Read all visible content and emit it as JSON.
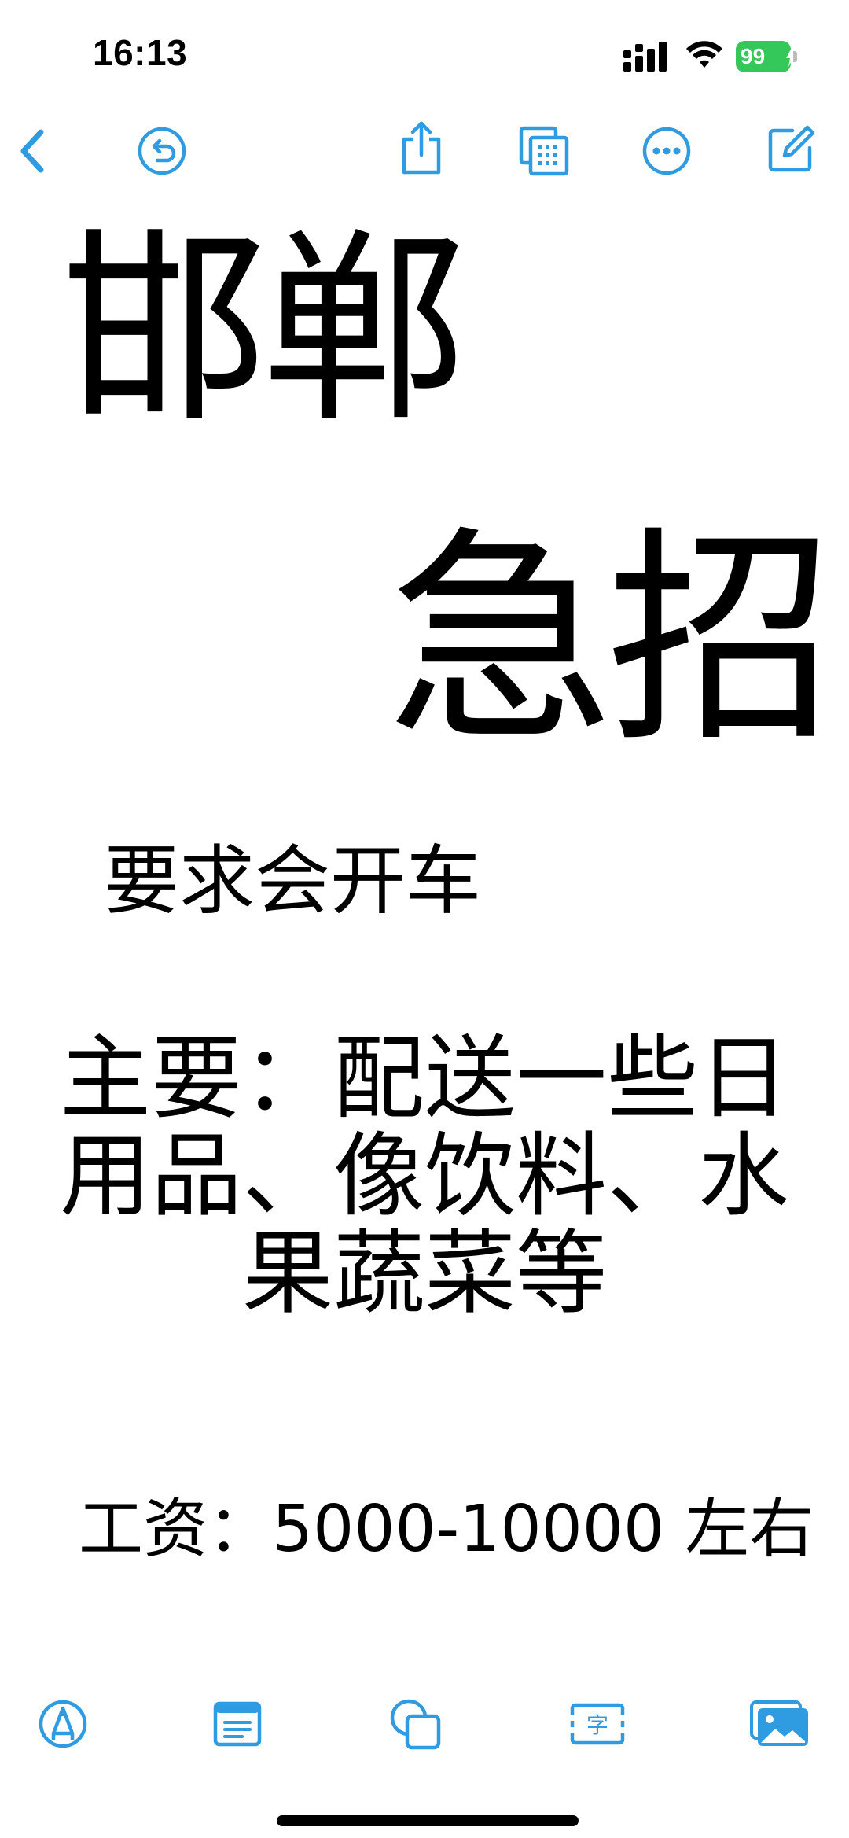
{
  "status_bar": {
    "time": "16:13",
    "battery_level": "99",
    "battery_charging": true,
    "icons": [
      "signal-icon",
      "wifi-icon",
      "battery-icon"
    ]
  },
  "toolbar": {
    "accent_color": "#2f9be0",
    "buttons": [
      "back-icon",
      "undo-icon",
      "share-icon",
      "gallery-icon",
      "more-icon",
      "compose-icon"
    ]
  },
  "note": {
    "headline_1": "邯郸",
    "headline_2": "急招",
    "requirement": "要求会开车",
    "duties": "主要：配送一些日用品、像饮料、水果蔬菜等",
    "salary": "工资：5000-10000 左右"
  },
  "bottom_toolbar": {
    "buttons": [
      "markup-icon",
      "table-icon",
      "shape-icon",
      "text-icon",
      "photo-icon"
    ]
  }
}
